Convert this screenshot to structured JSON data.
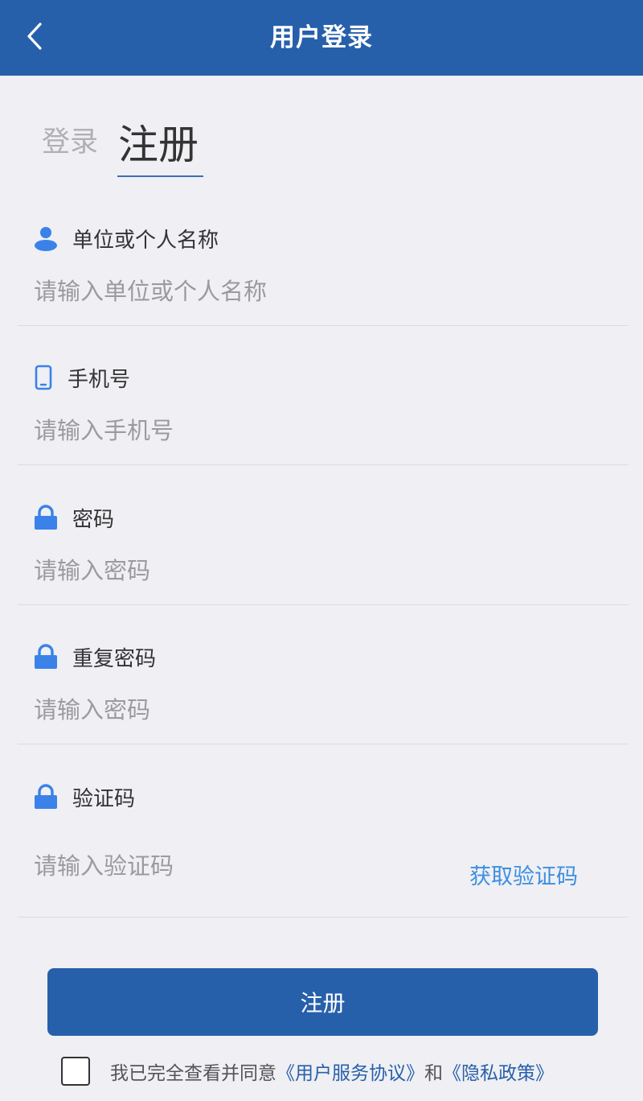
{
  "header": {
    "title": "用户登录"
  },
  "tabs": {
    "login": "登录",
    "register": "注册"
  },
  "fields": {
    "name": {
      "label": "单位或个人名称",
      "placeholder": "请输入单位或个人名称"
    },
    "phone": {
      "label": "手机号",
      "placeholder": "请输入手机号"
    },
    "password": {
      "label": "密码",
      "placeholder": "请输入密码"
    },
    "repeat_password": {
      "label": "重复密码",
      "placeholder": "请输入密码"
    },
    "code": {
      "label": "验证码",
      "placeholder": "请输入验证码",
      "get_code": "获取验证码"
    }
  },
  "submit_label": "注册",
  "agreement": {
    "text": "我已完全查看并同意",
    "terms_link": "《用户服务协议》",
    "and": "和",
    "privacy_link": "《隐私政策》"
  },
  "colors": {
    "primary": "#2760aa",
    "icon": "#3a82e8",
    "link": "#3d8fe0"
  }
}
